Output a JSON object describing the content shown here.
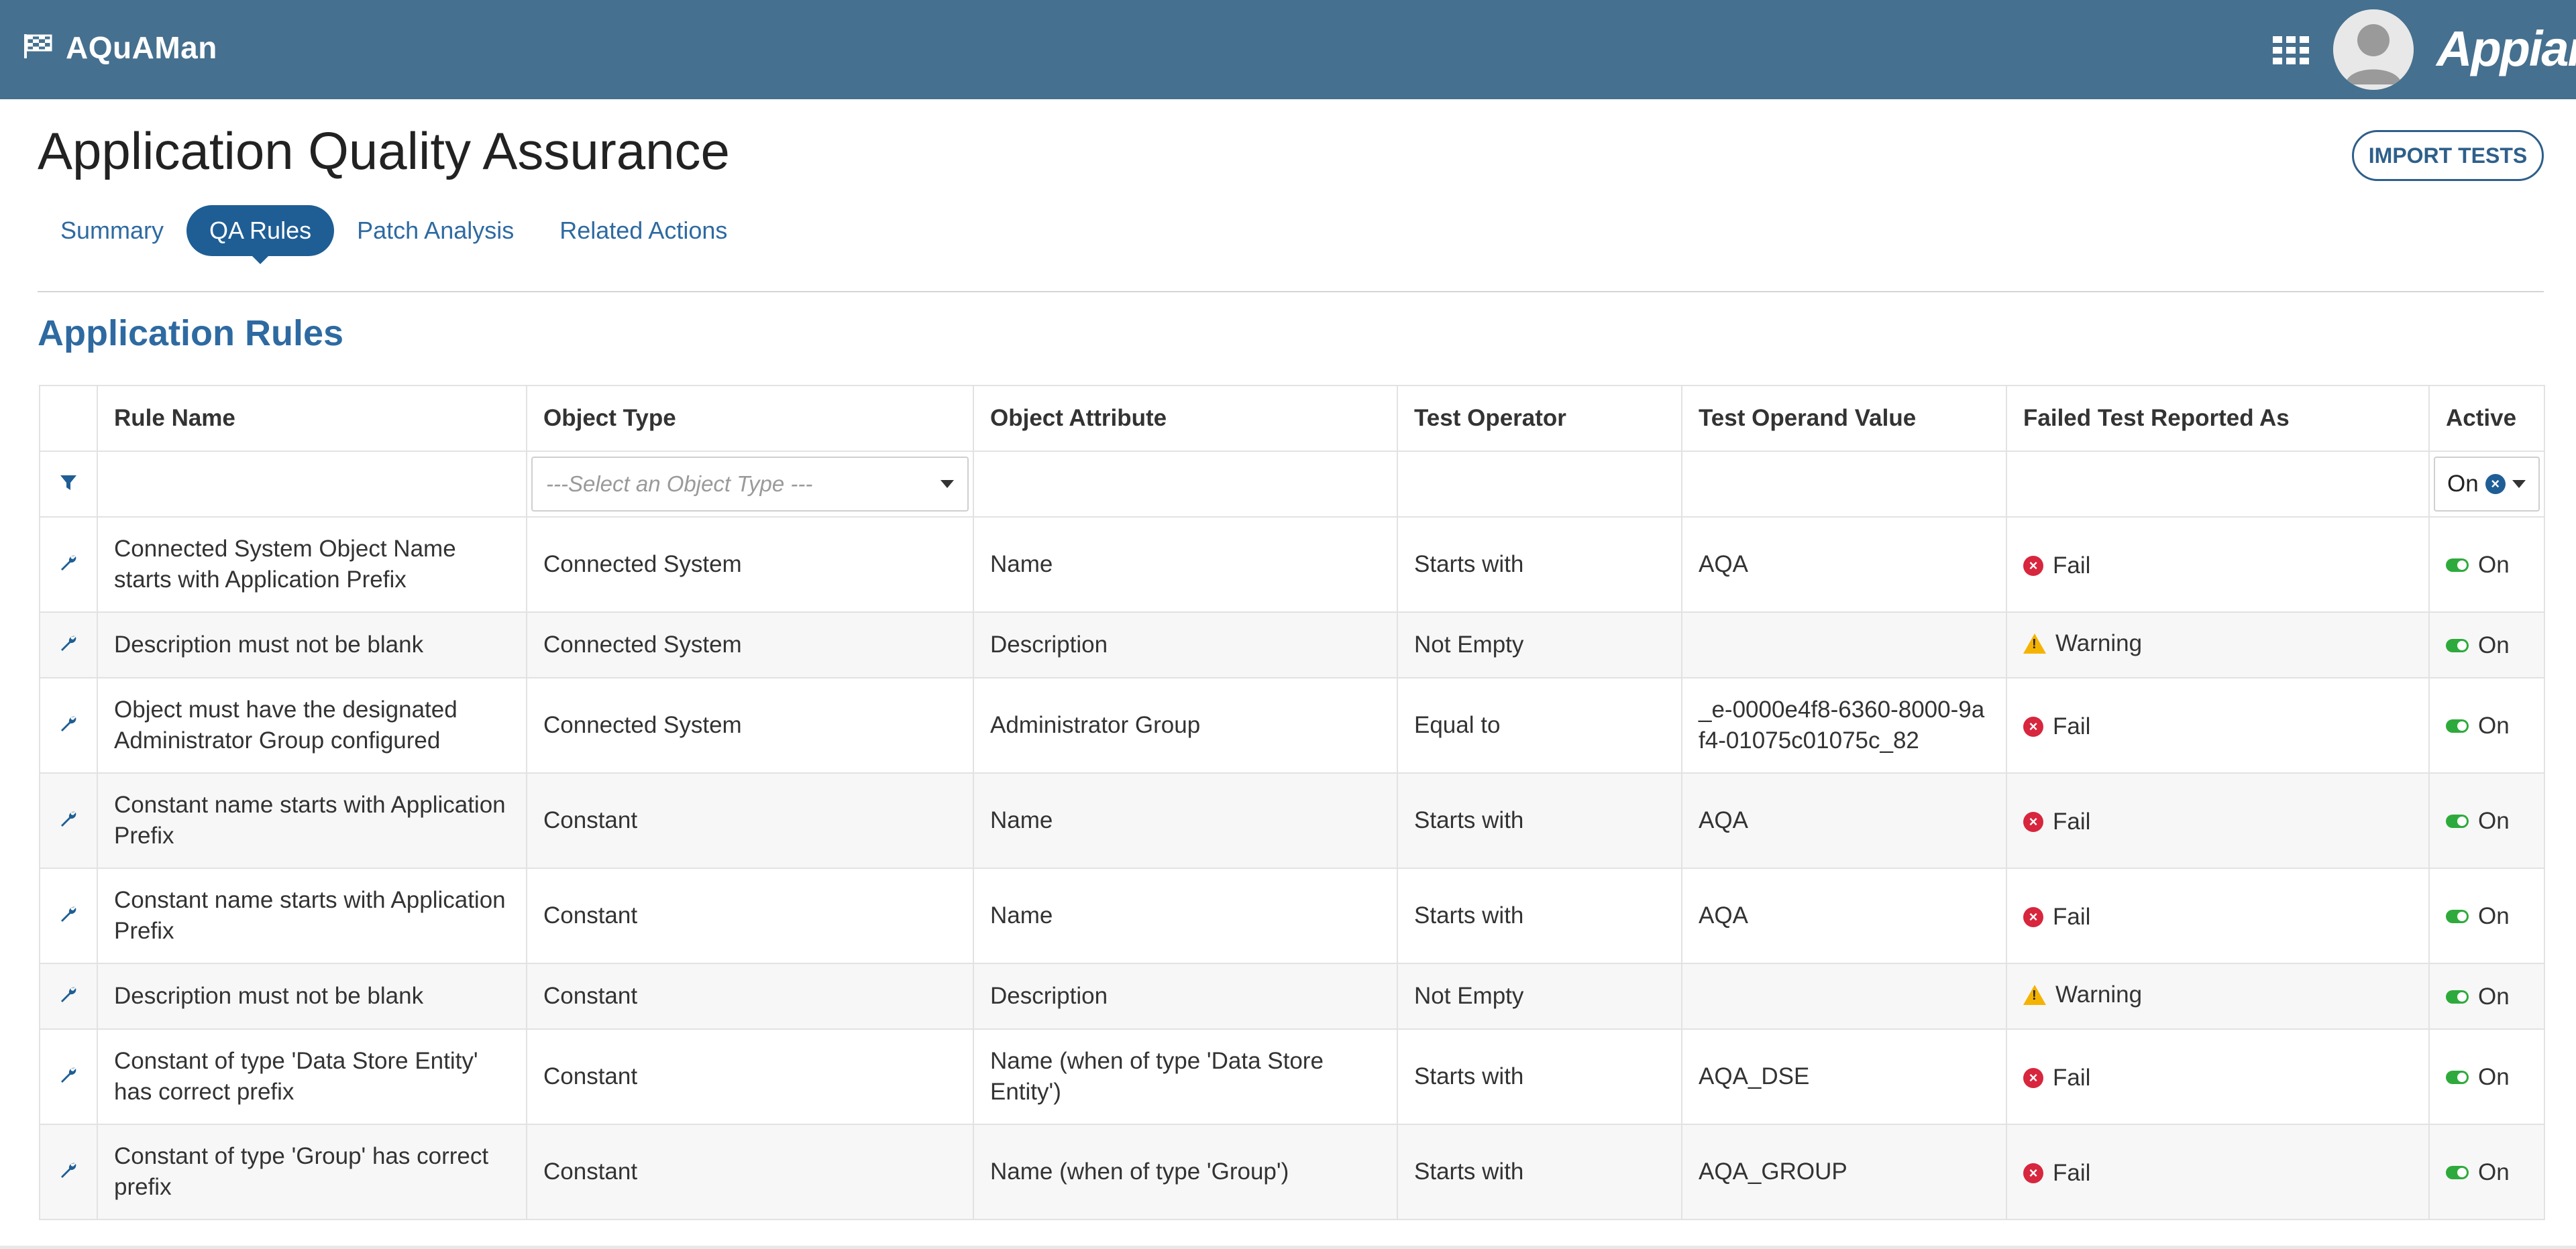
{
  "header": {
    "app_name": "AQuAMan",
    "brand_logo": "Appian",
    "icons": [
      "flag-icon",
      "apps-grid-icon",
      "user-avatar"
    ],
    "bar_color": "#46708f"
  },
  "page": {
    "title": "Application Quality Assurance",
    "import_button": "IMPORT TESTS",
    "tabs": [
      {
        "label": "Summary",
        "active": false
      },
      {
        "label": "QA Rules",
        "active": true
      },
      {
        "label": "Patch Analysis",
        "active": false
      },
      {
        "label": "Related Actions",
        "active": false
      }
    ],
    "section_title": "Application Rules"
  },
  "grid": {
    "columns": {
      "rule_name": "Rule Name",
      "object_type": "Object Type",
      "object_attribute": "Object Attribute",
      "test_operator": "Test Operator",
      "test_operand_value": "Test Operand Value",
      "failed_reported_as": "Failed Test Reported As",
      "active": "Active"
    },
    "filters": {
      "object_type_placeholder": "---Select an Object Type ---",
      "active_value": "On"
    },
    "rows": [
      {
        "rule": "Connected System Object Name starts with Application Prefix",
        "type": "Connected System",
        "attr": "Name",
        "op": "Starts with",
        "val": "AQA",
        "reported": "Fail",
        "active": "On"
      },
      {
        "rule": "Description must not be blank",
        "type": "Connected System",
        "attr": "Description",
        "op": "Not Empty",
        "val": "",
        "reported": "Warning",
        "active": "On"
      },
      {
        "rule": "Object must have the designated Administrator Group configured",
        "type": "Connected System",
        "attr": "Administrator Group",
        "op": "Equal to",
        "val": "_e-0000e4f8-6360-8000-9af4-01075c01075c_82",
        "reported": "Fail",
        "active": "On"
      },
      {
        "rule": "Constant name starts with Application Prefix",
        "type": "Constant",
        "attr": "Name",
        "op": "Starts with",
        "val": "AQA",
        "reported": "Fail",
        "active": "On"
      },
      {
        "rule": "Constant name starts with Application Prefix",
        "type": "Constant",
        "attr": "Name",
        "op": "Starts with",
        "val": "AQA",
        "reported": "Fail",
        "active": "On"
      },
      {
        "rule": "Description must not be blank",
        "type": "Constant",
        "attr": "Description",
        "op": "Not Empty",
        "val": "",
        "reported": "Warning",
        "active": "On"
      },
      {
        "rule": "Constant of type 'Data Store Entity' has correct prefix",
        "type": "Constant",
        "attr": "Name (when of type 'Data Store Entity')",
        "op": "Starts with",
        "val": "AQA_DSE",
        "reported": "Fail",
        "active": "On"
      },
      {
        "rule": "Constant of type 'Group' has correct prefix",
        "type": "Constant",
        "attr": "Name (when of type 'Group')",
        "op": "Starts with",
        "val": "AQA_GROUP",
        "reported": "Fail",
        "active": "On"
      }
    ]
  }
}
